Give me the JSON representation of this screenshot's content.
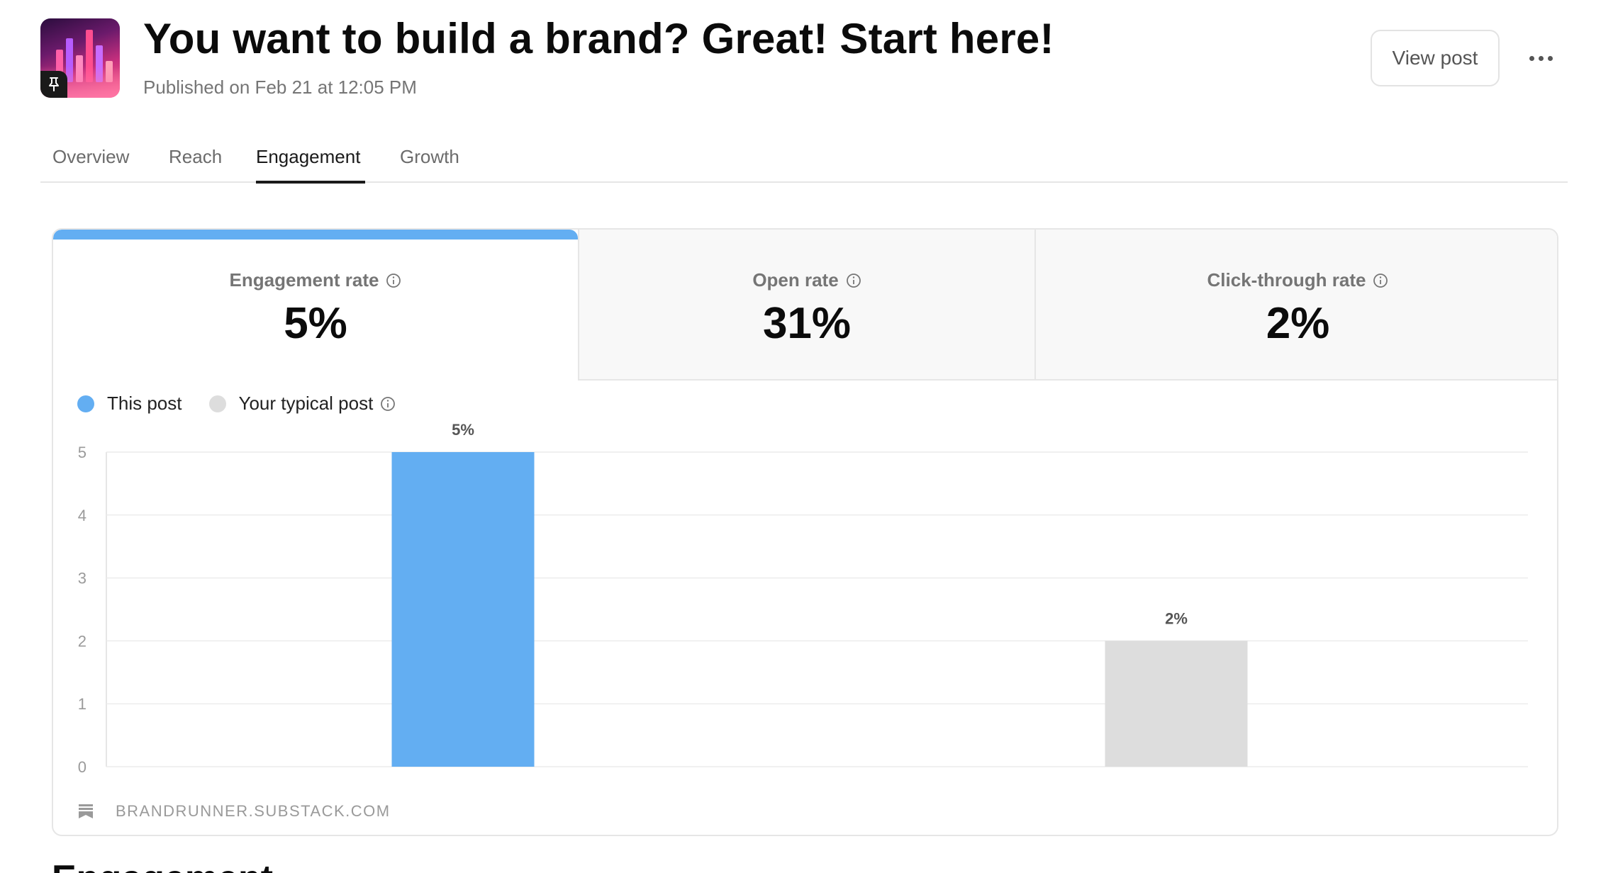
{
  "header": {
    "title": "You want to build a brand? Great! Start here!",
    "published": "Published on Feb 21 at 12:05 PM",
    "view_post_label": "View post"
  },
  "tabs": [
    {
      "label": "Overview",
      "active": false
    },
    {
      "label": "Reach",
      "active": false
    },
    {
      "label": "Engagement",
      "active": true
    },
    {
      "label": "Growth",
      "active": false
    }
  ],
  "metrics": [
    {
      "label": "Engagement rate",
      "value": "5%",
      "active": true
    },
    {
      "label": "Open rate",
      "value": "31%",
      "active": false
    },
    {
      "label": "Click-through rate",
      "value": "2%",
      "active": false
    }
  ],
  "legend": {
    "this_post": "This post",
    "typical_post": "Your typical post"
  },
  "colors": {
    "this_post": "#63aef2",
    "typical_post": "#dddddd",
    "accent": "#63aef2"
  },
  "chart_data": {
    "type": "bar",
    "categories": [
      "This post",
      "Your typical post"
    ],
    "values": [
      5,
      2
    ],
    "data_labels": [
      "5%",
      "2%"
    ],
    "y_ticks": [
      "0",
      "1",
      "2",
      "3",
      "4",
      "5"
    ],
    "ylim": [
      0,
      5
    ],
    "grid": true
  },
  "footer": {
    "source": "BRANDRUNNER.SUBSTACK.COM"
  },
  "section_title": "Engagement",
  "icons": {
    "pin": "pin-icon",
    "more": "more-horizontal-icon",
    "info": "info-icon",
    "substack": "substack-logo-icon"
  }
}
